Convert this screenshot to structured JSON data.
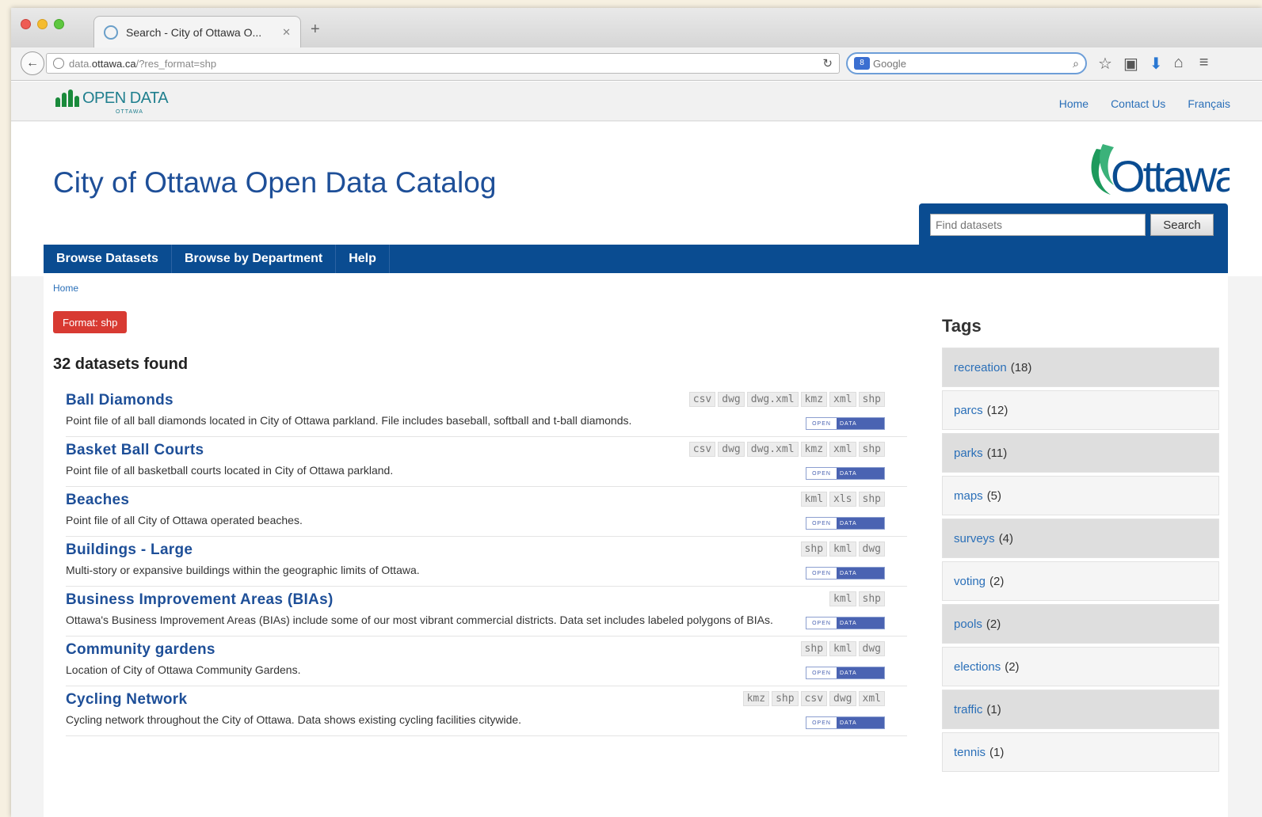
{
  "browser": {
    "tab_title": "Search - City of Ottawa O...",
    "url_domain": "data.",
    "url_host": "ottawa.ca",
    "url_path": "/?res_format=shp",
    "search_placeholder": "Google",
    "search_engine_glyph": "8"
  },
  "topbar": {
    "logo_text": "OPEN DATA",
    "logo_sub": "OTTAWA",
    "links": [
      "Home",
      "Contact Us",
      "Français"
    ]
  },
  "header": {
    "title": "City of Ottawa Open Data Catalog",
    "ottawa_logo_text": "Ottawa",
    "search_placeholder": "Find datasets",
    "search_button": "Search"
  },
  "main_nav": [
    "Browse Datasets",
    "Browse by Department",
    "Help"
  ],
  "breadcrumb": "Home",
  "filter_badge": "Format: shp",
  "results_count": "32 datasets found",
  "open_data_badge": {
    "left": "OPEN",
    "right": "DATA"
  },
  "datasets": [
    {
      "title": "Ball Diamonds",
      "description": "Point file of all ball diamonds located in City of Ottawa parkland. File includes baseball, softball and t-ball diamonds.",
      "formats": [
        "csv",
        "dwg",
        "dwg.xml",
        "kmz",
        "xml",
        "shp"
      ]
    },
    {
      "title": "Basket Ball Courts",
      "description": "Point file of all basketball courts located in City of Ottawa parkland.",
      "formats": [
        "csv",
        "dwg",
        "dwg.xml",
        "kmz",
        "xml",
        "shp"
      ]
    },
    {
      "title": "Beaches",
      "description": "Point file of all City of Ottawa operated beaches.",
      "formats": [
        "kml",
        "xls",
        "shp"
      ]
    },
    {
      "title": "Buildings - Large",
      "description": "Multi-story or expansive buildings within the geographic limits of Ottawa.",
      "formats": [
        "shp",
        "kml",
        "dwg"
      ]
    },
    {
      "title": "Business Improvement Areas (BIAs)",
      "description": "Ottawa's Business Improvement Areas (BIAs) include some of our most vibrant commercial districts. Data set includes labeled polygons of BIAs.",
      "formats": [
        "kml",
        "shp"
      ]
    },
    {
      "title": "Community gardens",
      "description": "Location of City of Ottawa Community Gardens.",
      "formats": [
        "shp",
        "kml",
        "dwg"
      ]
    },
    {
      "title": "Cycling Network",
      "description": "Cycling network throughout the City of Ottawa. Data shows existing cycling facilities citywide.",
      "formats": [
        "kmz",
        "shp",
        "csv",
        "dwg",
        "xml"
      ]
    }
  ],
  "tags": {
    "heading": "Tags",
    "items": [
      {
        "name": "recreation",
        "count": "(18)"
      },
      {
        "name": "parcs",
        "count": "(12)"
      },
      {
        "name": "parks",
        "count": "(11)"
      },
      {
        "name": "maps",
        "count": "(5)"
      },
      {
        "name": "surveys",
        "count": "(4)"
      },
      {
        "name": "voting",
        "count": "(2)"
      },
      {
        "name": "pools",
        "count": "(2)"
      },
      {
        "name": "elections",
        "count": "(2)"
      },
      {
        "name": "traffic",
        "count": "(1)"
      },
      {
        "name": "tennis",
        "count": "(1)"
      }
    ]
  },
  "colors": {
    "brand_blue": "#0a4c91",
    "title_blue": "#1e4f98",
    "link_blue": "#2a6fb8",
    "badge_red": "#d83a32",
    "logo_green": "#1a8a3b"
  },
  "icons": [
    "globe-icon",
    "reload-icon",
    "magnifier-icon",
    "star-icon",
    "clipboard-icon",
    "download-icon",
    "home-icon",
    "menu-icon",
    "back-arrow-icon"
  ]
}
